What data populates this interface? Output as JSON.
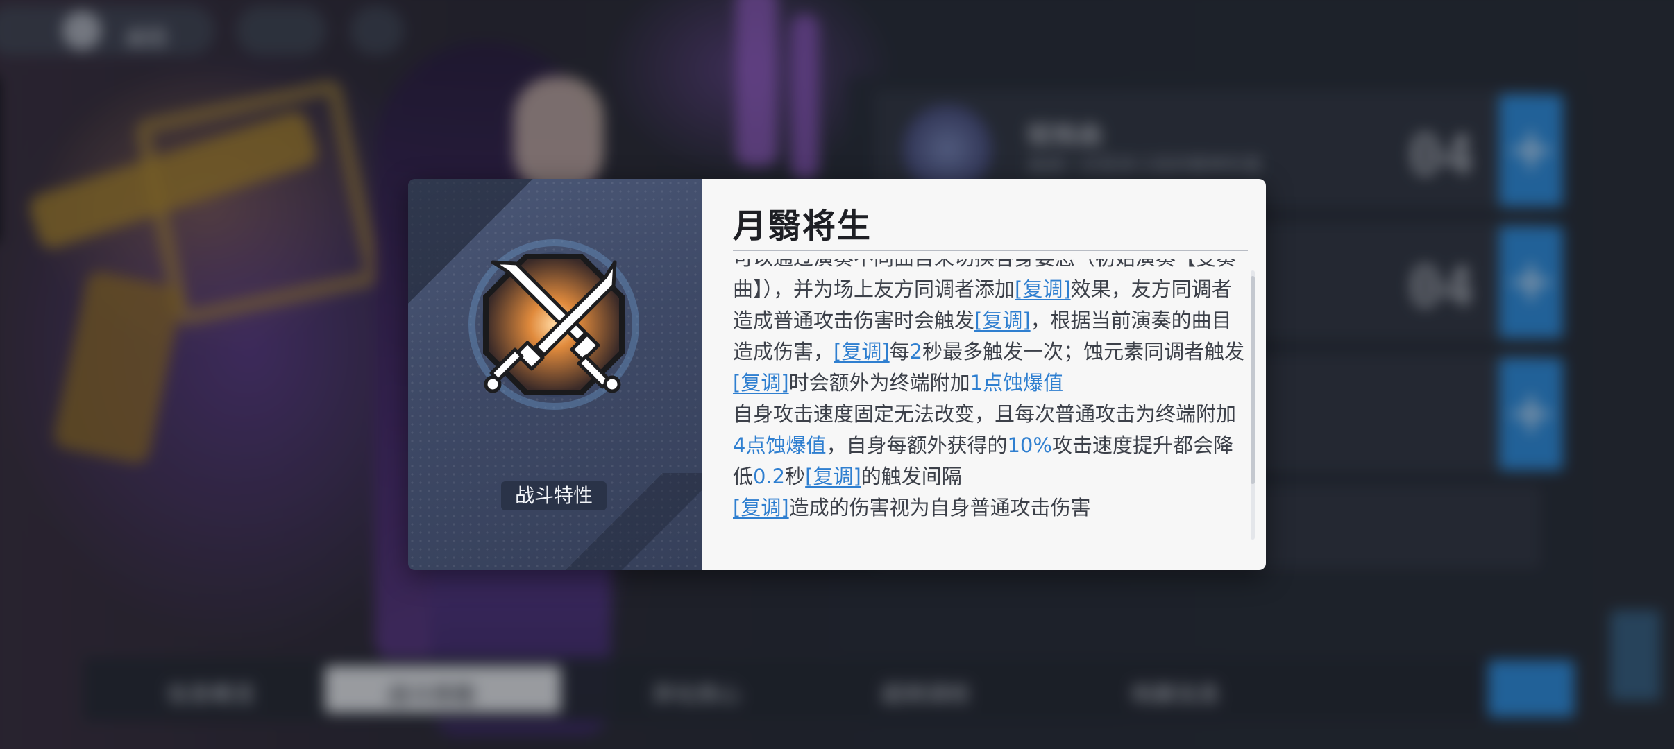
{
  "modal": {
    "category_label": "战斗特性",
    "skill_name": "月翳将生",
    "description": [
      {
        "segs": [
          {
            "t": "可以通过演奏不同曲目来切换各身姿态（初始演奏【变奏曲】），并为场上友方同调者添加"
          },
          {
            "t": "[复调]",
            "k": "kw"
          },
          {
            "t": "效果，友方同调者造成普通攻击伤害时会触发"
          },
          {
            "t": "[复调]",
            "k": "kw"
          },
          {
            "t": "，根据当前演奏的曲目造成伤害，"
          },
          {
            "t": "[复调]",
            "k": "kw"
          },
          {
            "t": "每"
          },
          {
            "t": "2",
            "k": "num"
          },
          {
            "t": "秒最多触发一次；蚀元素同调者触发"
          },
          {
            "t": "[复调]",
            "k": "kw"
          },
          {
            "t": "时会额外为终端附加"
          },
          {
            "t": "1点蚀爆值",
            "k": "num"
          }
        ]
      },
      {
        "segs": [
          {
            "t": "自身攻击速度固定无法改变，且每次普通攻击为终端附加"
          },
          {
            "t": "4点蚀爆值",
            "k": "num"
          },
          {
            "t": "，自身每额外获得的"
          },
          {
            "t": "10%",
            "k": "num"
          },
          {
            "t": "攻击速度提升都会降低"
          },
          {
            "t": "0.2",
            "k": "num"
          },
          {
            "t": "秒"
          },
          {
            "t": "[复调]",
            "k": "kw"
          },
          {
            "t": "的触发间隔"
          }
        ]
      },
      {
        "segs": [
          {
            "t": "[复调]",
            "k": "kw"
          },
          {
            "t": "造成的伤害视为自身普通攻击伤害"
          }
        ]
      }
    ]
  },
  "background": {
    "top_buttons": [
      "返回"
    ],
    "skill_rows": [
      {
        "name": "赋格曲",
        "desc": "造成一次至多三段的精神伤害",
        "level": "04"
      },
      {
        "name": "",
        "desc": "",
        "level": "04"
      },
      {
        "name": "",
        "desc": "",
        "level": ""
      }
    ],
    "bottom_tabs": [
      "信息概览",
      "战斗技能",
      "异化核心",
      "超频调校",
      "档案信息"
    ],
    "active_tab_index": 1
  },
  "colors": {
    "accent_blue": "#2f7fd0",
    "button_blue": "#2f8fe0"
  },
  "icons": [
    "crossed-swords-icon",
    "plus-icon",
    "help-icon",
    "back-icon"
  ]
}
